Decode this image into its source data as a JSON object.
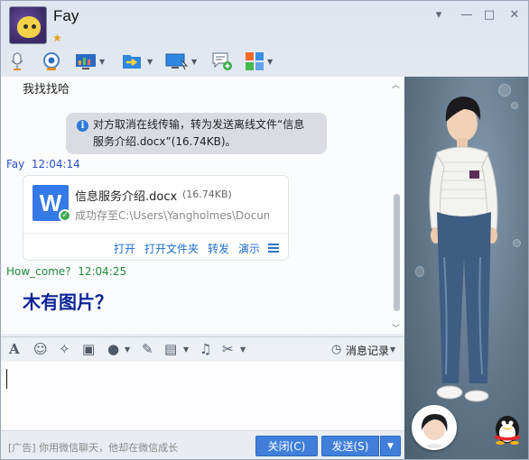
{
  "window": {
    "nickname": "Fay",
    "controls": [
      "▾",
      "—",
      "□",
      "✕"
    ]
  },
  "toolbar": {
    "icons": [
      "microphone-icon",
      "video-call-icon",
      "screen-share-icon",
      "send-file-icon",
      "remote-desktop-icon",
      "add-app-icon",
      "apps-icon"
    ]
  },
  "chat": {
    "top_message": "我找找哈",
    "notice_line1": "对方取消在线传输，转为发送离线文件“信息",
    "notice_line2": "服务介绍.docx”(16.74KB)。",
    "msg1_sender": "Fay",
    "msg1_time": "12:04:14",
    "file": {
      "name": "信息服务介绍.docx",
      "size": "(16.74KB)",
      "status": "成功存至C:\\Users\\Yangholmes\\Docume...",
      "actions": [
        "打开",
        "打开文件夹",
        "转发",
        "演示"
      ]
    },
    "msg2_sender": "How_come?",
    "msg2_time": "12:04:25",
    "msg2_text": "木有图片？"
  },
  "input_toolbar": {
    "history_label": "消息记录"
  },
  "bottom": {
    "ad_text": "[广告] 你用微信聊天，他却在微信成长",
    "close_label": "关闭(C)",
    "send_label": "发送(S)"
  },
  "colors": {
    "accent": "#3f7fd9",
    "sender_self": "#2a4fc9",
    "sender_other": "#1e8a3a",
    "link": "#1b6fd1"
  }
}
